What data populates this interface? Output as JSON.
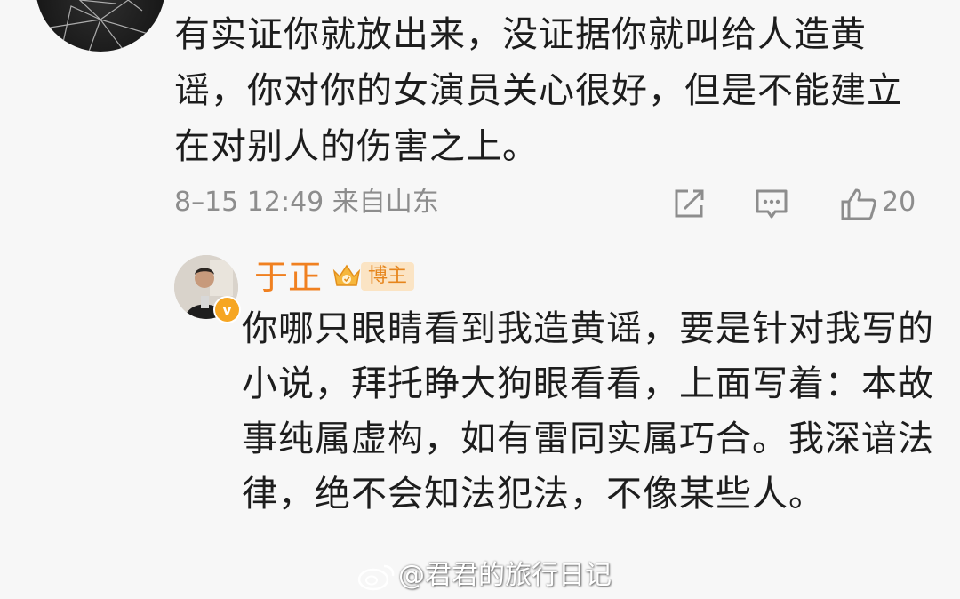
{
  "comment": {
    "text": "有实证你就放出来，没证据你就叫给人造黄谣，你对你的女演员关心很好，但是不能建立在对别人的伤害之上。",
    "meta": "8–15 12:49  来自山东",
    "like_count": "20"
  },
  "reply": {
    "name": "于正",
    "badge_label": "博主",
    "verified_mark": "v",
    "text": "你哪只眼睛看到我造黄谣，要是针对我写的小说，拜托睁大狗眼看看，上面写着：本故事纯属虚构，如有雷同实属巧合。我深谙法律，绝不会知法犯法，不像某些人。"
  },
  "watermark": {
    "text": "@君君的旅行日记"
  },
  "colors": {
    "background": "#f7f7f7",
    "text": "#1d1d1d",
    "meta": "#8d8d8d",
    "name": "#f08020",
    "badge_bg": "#fbe4c4"
  },
  "icons": [
    "share-icon",
    "comment-icon",
    "like-icon",
    "crown-icon",
    "weibo-logo-icon"
  ]
}
